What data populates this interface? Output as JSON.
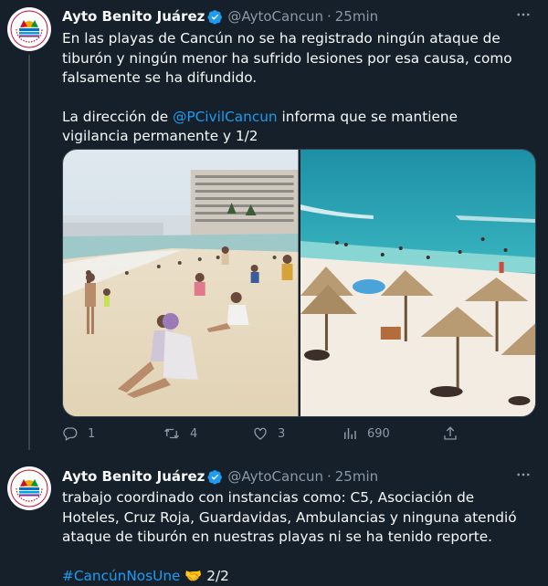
{
  "tweets": [
    {
      "name": "Ayto Benito Juárez",
      "handle": "@AytoCancun",
      "separator": "·",
      "time": "25min",
      "text_line1": "En las playas de Cancún no se ha registrado ningún ataque de tiburón y ningún menor ha sufrido lesiones por esa causa, como falsamente se ha difundido.",
      "text_pre_mention": "La dirección de ",
      "mention": "@PCivilCancun",
      "text_post_mention": " informa que se mantiene vigilancia permanente y 1/2",
      "stats": {
        "replies": "1",
        "retweets": "4",
        "likes": "3",
        "views": "690"
      }
    },
    {
      "name": "Ayto Benito Juárez",
      "handle": "@AytoCancun",
      "separator": "·",
      "time": "25min",
      "text": "trabajo coordinado con instancias como: C5, Asociación de Hoteles, Cruz Roja, Guardavidas, Ambulancias y ninguna atendió ataque de tiburón en nuestras playas ni se ha tenido reporte.",
      "hashtag": "#CancúnNosUne",
      "emoji": "🤝",
      "suffix": "2/2"
    }
  ],
  "icons": {
    "reply": "reply-icon",
    "retweet": "retweet-icon",
    "like": "like-icon",
    "views": "views-icon",
    "share": "share-icon",
    "verified": "verified-badge-icon",
    "more": "more-options-icon"
  },
  "colors": {
    "background": "#15202b",
    "link": "#1d9bf0",
    "muted": "#8b98a5",
    "verified": "#1d9bf0"
  }
}
